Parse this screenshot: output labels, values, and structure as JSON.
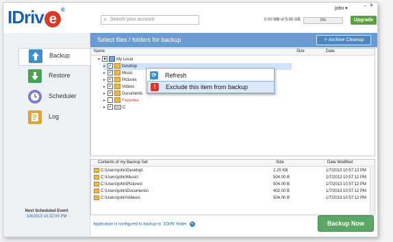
{
  "app": {
    "logo_text": "IDriv",
    "logo_e": "e",
    "logo_reg": "®"
  },
  "topbar": {
    "search_placeholder": "Search your account",
    "usage_text": "0.00 MB of 5.00 GB",
    "progress_percent": 0,
    "progress_label": "0%",
    "upgrade_label": "Upgrade",
    "user_label": "john ▾"
  },
  "colors": {
    "accent": "#6b9bd1",
    "brand": "#1c5ea8",
    "upgrade": "#5a9e3e",
    "backup_now": "#5aa864"
  },
  "sidebar": {
    "items": [
      {
        "label": "Backup",
        "icon": "backup-arrow-icon"
      },
      {
        "label": "Restore",
        "icon": "restore-arrow-icon"
      },
      {
        "label": "Scheduler",
        "icon": "clock-icon"
      },
      {
        "label": "Log",
        "icon": "log-document-icon"
      }
    ],
    "next_event_title": "Next Scheduled Event",
    "next_event_time": "1/8/2013 10:32:00 PM"
  },
  "header": {
    "title": "Select  files / folders  for backup",
    "archive_label": "Archive Cleanup"
  },
  "tree": {
    "columns": [
      "Name",
      "Size",
      "Date"
    ],
    "root": "My Local",
    "items": [
      "Desktop",
      "Music",
      "Pictures",
      "Videos",
      "Documents",
      "Favorites",
      "C"
    ]
  },
  "context_menu": {
    "items": [
      "Refresh",
      "Exclude this item from backup"
    ]
  },
  "backup_set": {
    "columns": [
      "Contents of my Backup Set",
      "Size",
      "Date Modified"
    ],
    "rows": [
      {
        "path": "C:\\Users\\john\\Desktop\\",
        "size": "2.25 KB",
        "date": "1/7/2013 10:57:12 PM"
      },
      {
        "path": "C:\\Users\\john\\Music\\",
        "size": "504.00 B",
        "date": "1/7/2013 10:57:12 PM"
      },
      {
        "path": "C:\\Users\\john\\Pictures\\",
        "size": "504.00 B",
        "date": "1/7/2013 10:57:12 PM"
      },
      {
        "path": "C:\\Users\\john\\Documents\\",
        "size": "402.00 B",
        "date": "1/7/2013 10:57:12 PM"
      },
      {
        "path": "C:\\Users\\john\\Videos\\",
        "size": "504.00 B",
        "date": "1/7/2013 10:57:12 PM"
      }
    ]
  },
  "footer": {
    "message": "Application is configured to backup to 'JOHN' folder.",
    "backup_now_label": "Backup Now"
  }
}
